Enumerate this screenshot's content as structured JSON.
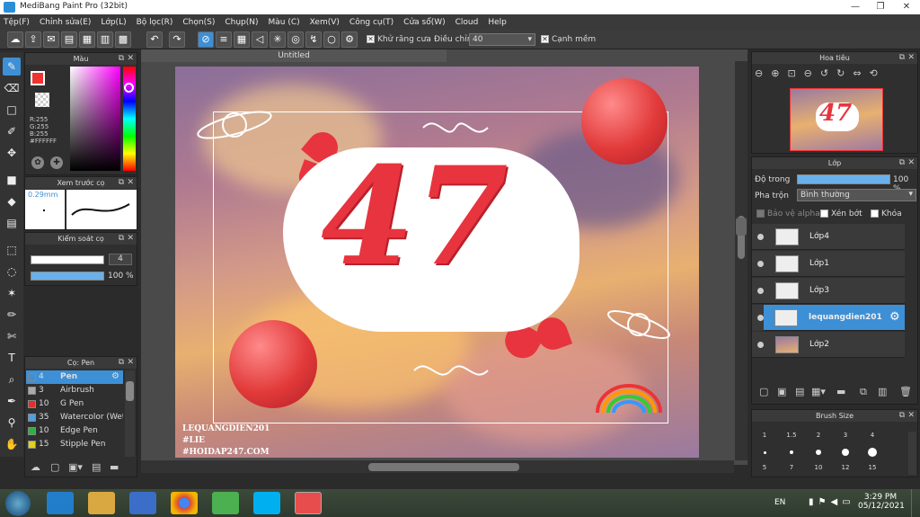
{
  "window": {
    "title": "MediBang Paint Pro (32bit)"
  },
  "menu": [
    "Tệp(F)",
    "Chỉnh sửa(E)",
    "Lớp(L)",
    "Bộ lọc(R)",
    "Chọn(S)",
    "Chụp(N)",
    "Màu (C)",
    "Xem(V)",
    "Công cụ(T)",
    "Cửa sổ(W)",
    "Cloud",
    "Help"
  ],
  "toolbar": {
    "antialias_label": "Khử răng cưa",
    "adjust_label": "Điều chỉnh",
    "adjust_value": "40",
    "snap_label": "Cạnh mềm"
  },
  "color_panel": {
    "title": "Màu",
    "r": "R:255",
    "g": "G:255",
    "b": "B:255",
    "hex": "#FFFFFF"
  },
  "brush_preview": {
    "title": "Xem trước cọ",
    "size": "0.29mm"
  },
  "brush_control": {
    "title": "Kiểm soát cọ",
    "size_value": "4",
    "opacity_value": "100 %"
  },
  "brush_list": {
    "title": "Cọ: Pen",
    "items": [
      {
        "num": "4",
        "label": "Pen",
        "color": "#3d8fd6"
      },
      {
        "num": "3",
        "label": "Airbrush",
        "color": "#aaaaaa"
      },
      {
        "num": "10",
        "label": "G Pen",
        "color": "#e03030"
      },
      {
        "num": "35",
        "label": "Watercolor (Wet)",
        "color": "#4fa0e0"
      },
      {
        "num": "10",
        "label": "Edge Pen",
        "color": "#30b040"
      },
      {
        "num": "15",
        "label": "Stipple Pen",
        "color": "#e0d020"
      }
    ]
  },
  "document": {
    "tab": "Untitled",
    "art_text": "47",
    "watermark": [
      "LEQUANGDIEN201",
      "#LIE",
      "#HOIDAP247.COM"
    ]
  },
  "navigator": {
    "title": "Hoa tiêu"
  },
  "layers_panel": {
    "title": "Lớp",
    "opacity_label": "Độ trong",
    "opacity_value": "100 %",
    "blend_label": "Pha trộn",
    "blend_value": "Bình thường",
    "protect_alpha": "Bảo vệ alpha",
    "clip": "Xén bớt",
    "lock": "Khóa",
    "layers": [
      "Lớp4",
      "Lớp1",
      "Lớp3",
      "lequangdien201",
      "Lớp2"
    ]
  },
  "brush_size": {
    "title": "Brush Size",
    "row1": [
      "1",
      "1.5",
      "2",
      "3",
      "4"
    ],
    "row2": [
      "5",
      "7",
      "10",
      "12",
      "15"
    ]
  },
  "taskbar": {
    "lang": "EN",
    "time": "3:29 PM",
    "date": "05/12/2021"
  },
  "colors": {
    "accent": "#3d8fd6",
    "art_red": "#e8343e"
  }
}
